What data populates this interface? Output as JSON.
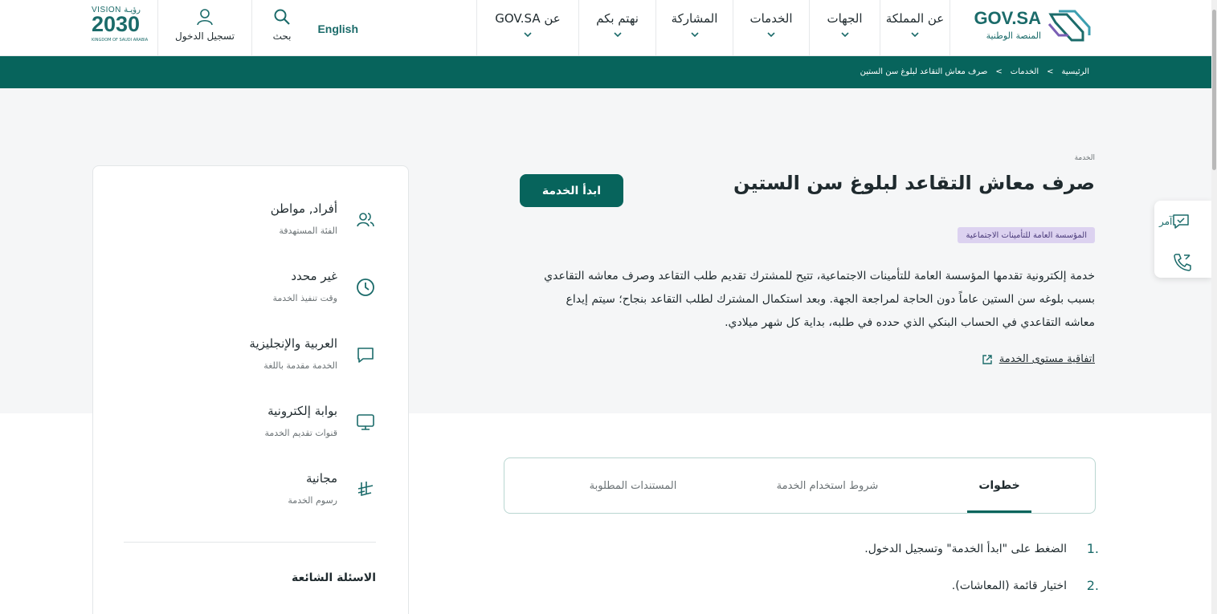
{
  "header": {
    "logo": {
      "brand": "GOV.SA",
      "subtitle": "المنصة الوطنية"
    },
    "nav": [
      {
        "label": "عن المملكة"
      },
      {
        "label": "الجهات"
      },
      {
        "label": "الخدمات"
      },
      {
        "label": "المشاركة"
      },
      {
        "label": "نهتم بكم"
      },
      {
        "label": "عن GOV.SA"
      }
    ],
    "language": "English",
    "search_label": "بحث",
    "login_label": "تسجيل الدخول",
    "vision": {
      "line1": "VISION رؤيـة",
      "line2": "2030",
      "line3": "KINGDOM OF SAUDI ARABIA"
    }
  },
  "breadcrumb": [
    "الرئيسية",
    ">",
    "الخدمات",
    ">",
    "صرف معاش التقاعد لبلوغ سن الستين"
  ],
  "service": {
    "eyebrow": "الخدمة",
    "title": "صرف معاش التقاعد لبلوغ سن الستين",
    "start_button": "ابدأ الخدمة",
    "agency": "المؤسسة العامة للتأمينات الاجتماعية",
    "description": "خدمة إلكترونية تقدمها المؤسسة العامة للتأمينات الاجتماعية، تتيح للمشترك تقديم طلب التقاعد وصرف معاشه التقاعدي بسبب بلوغه سن الستين عاماً دون الحاجة لمراجعة الجهة. وبعد استكمال المشترك لطلب التقاعد بنجاح؛ سيتم إيداع معاشه التقاعدي في الحساب البنكي الذي حدده في طلبه، بداية كل شهر ميلادي.",
    "sla_link": "اتفاقية مستوى الخدمة"
  },
  "sidebar": {
    "items": [
      {
        "value": "أفراد, مواطن",
        "label": "الفئة المستهدفة",
        "icon": "users-icon"
      },
      {
        "value": "غير محدد",
        "label": "وقت تنفيذ الخدمة",
        "icon": "clock-icon"
      },
      {
        "value": "العربية والإنجليزية",
        "label": "الخدمة مقدمة باللغة",
        "icon": "chat-icon"
      },
      {
        "value": "بوابة إلكترونية",
        "label": "قنوات تقديم الخدمة",
        "icon": "monitor-icon"
      },
      {
        "value": "مجانية",
        "label": "رسوم الخدمة",
        "icon": "riyal-icon"
      }
    ],
    "faq_title": "الاسئلة الشائعة"
  },
  "tabs": [
    {
      "label": "خطوات",
      "active": true
    },
    {
      "label": "شروط استخدام الخدمة",
      "active": false
    },
    {
      "label": "المستندات المطلوبة",
      "active": false
    }
  ],
  "steps": [
    {
      "num": "1.",
      "text": "الضغط على \"ابدأ الخدمة\" وتسجيل الدخول."
    },
    {
      "num": "2.",
      "text": "اختيار قائمة (المعاشات)."
    }
  ],
  "float_widget": {
    "amr_label": "آمر"
  },
  "colors": {
    "primary": "#07645c",
    "accent": "#1b6b6a",
    "badge_bg": "#dcd2f0"
  }
}
